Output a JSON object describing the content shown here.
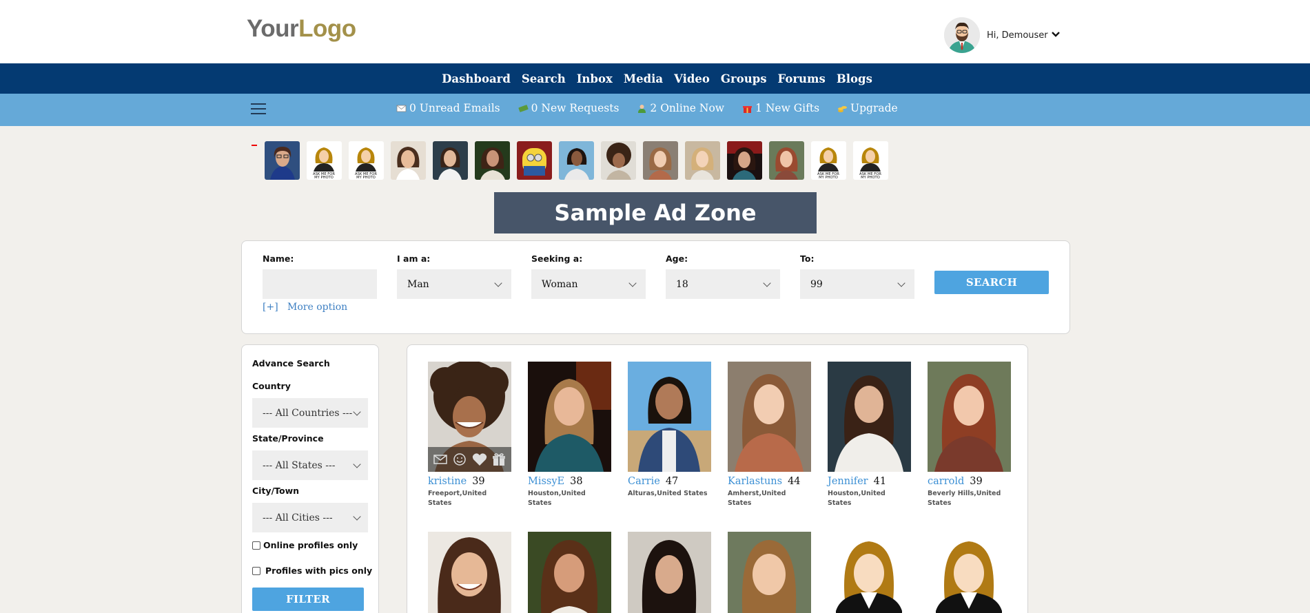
{
  "header": {
    "logo_part1": "Your",
    "logo_part2": "Logo",
    "greeting": "Hi, Demouser"
  },
  "main_nav": [
    "Dashboard",
    "Search",
    "Inbox",
    "Media",
    "Video",
    "Groups",
    "Forums",
    "Blogs"
  ],
  "sub_nav": [
    {
      "label": "0 Unread Emails",
      "icon": "envelope-icon"
    },
    {
      "label": "0 New Requests",
      "icon": "money-icon"
    },
    {
      "label": "2 Online Now",
      "icon": "person-icon"
    },
    {
      "label": "1 New Gifts",
      "icon": "gift-icon"
    },
    {
      "label": "Upgrade",
      "icon": "coins-icon"
    }
  ],
  "thumb_placeholder_text": [
    "ASK ME FOR",
    "MY PHOTO"
  ],
  "ad_zone": {
    "label": "Sample Ad Zone"
  },
  "search": {
    "name_label": "Name:",
    "name_value": "",
    "iam_label": "I am a:",
    "iam_value": "Man",
    "seeking_label": "Seeking a:",
    "seeking_value": "Woman",
    "age_label": "Age:",
    "age_value": "18",
    "to_label": "To:",
    "to_value": "99",
    "button": "SEARCH",
    "more_prefix": "[+]",
    "more_label": "More option"
  },
  "advance": {
    "title": "Advance Search",
    "country_label": "Country",
    "country_value": "--- All Countries ---",
    "state_label": "State/Province",
    "state_value": "--- All States ---",
    "city_label": "City/Town",
    "city_value": "--- All Cities ---",
    "online_label": "Online profiles only",
    "pics_label": "Profiles with pics only",
    "filter_button": "FILTER"
  },
  "profiles": [
    {
      "name": "kristine",
      "age": "39",
      "location": "Freeport,United States"
    },
    {
      "name": "MissyE",
      "age": "38",
      "location": "Houston,United States"
    },
    {
      "name": "Carrie",
      "age": "47",
      "location": "Alturas,United States"
    },
    {
      "name": "Karlastuns",
      "age": "44",
      "location": "Amherst,United States"
    },
    {
      "name": "Jennifer",
      "age": "41",
      "location": "Houston,United States"
    },
    {
      "name": "carrold",
      "age": "39",
      "location": "Beverly Hills,United States"
    }
  ],
  "colors": {
    "nav_dark": "#043a72",
    "nav_light": "#65a9d8",
    "accent": "#4ea4e0",
    "link": "#3b8fd4"
  }
}
